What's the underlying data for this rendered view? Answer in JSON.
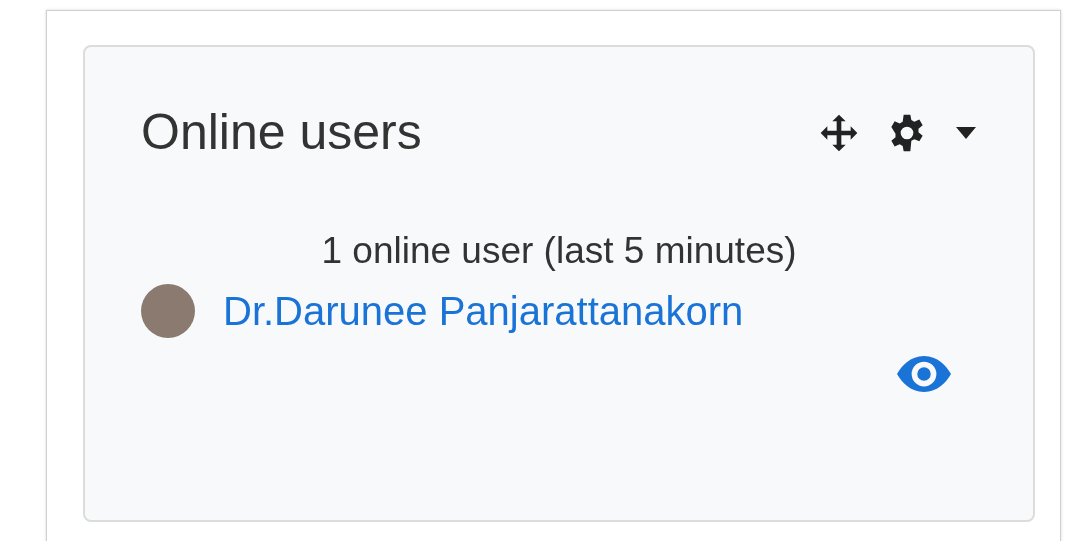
{
  "block": {
    "title": "Online users",
    "summary": "1 online user (last 5 minutes)",
    "users": [
      {
        "name": "Dr.Darunee Panjarattanakorn"
      }
    ]
  }
}
